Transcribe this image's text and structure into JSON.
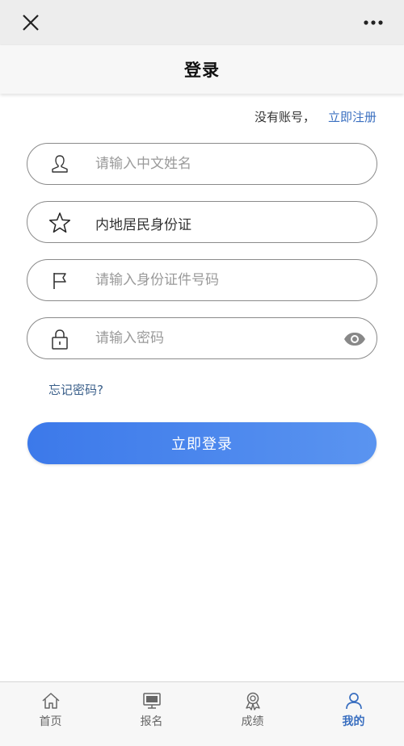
{
  "header": {
    "title": "登录"
  },
  "register": {
    "prompt": "没有账号，",
    "link": "立即注册"
  },
  "form": {
    "name_placeholder": "请输入中文姓名",
    "id_type_value": "内地居民身份证",
    "id_number_placeholder": "请输入身份证件号码",
    "password_placeholder": "请输入密码"
  },
  "forgot_password": "忘记密码?",
  "login_button": "立即登录",
  "tabs": [
    {
      "label": "首页",
      "icon": "home-icon"
    },
    {
      "label": "报名",
      "icon": "monitor-icon"
    },
    {
      "label": "成绩",
      "icon": "award-icon"
    },
    {
      "label": "我的",
      "icon": "user-icon",
      "active": true
    }
  ],
  "colors": {
    "accent": "#3a6fc0",
    "button_start": "#3c79ea",
    "button_end": "#5a94f0"
  }
}
